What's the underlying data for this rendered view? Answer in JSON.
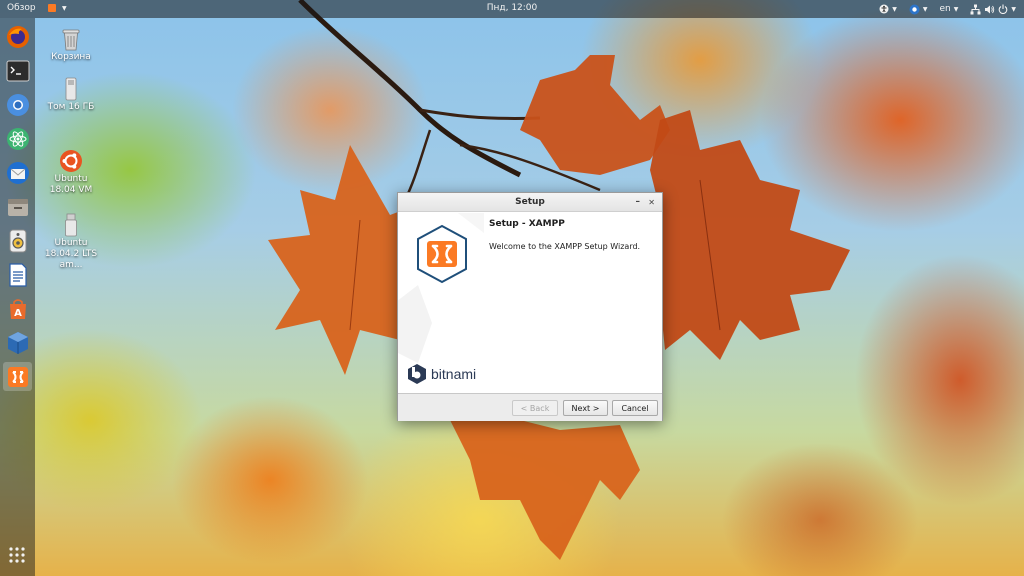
{
  "topbar": {
    "activities_label": "Обзор",
    "app_menu_icon": "xampp-icon",
    "clock": "Пнд, 12:00",
    "language": "en",
    "tray_icons": [
      "accessibility-icon",
      "browser-icon",
      "network-icon",
      "volume-icon",
      "power-icon"
    ]
  },
  "dock": {
    "items": [
      {
        "name": "firefox",
        "icon": "firefox-icon"
      },
      {
        "name": "terminal",
        "icon": "terminal-icon"
      },
      {
        "name": "chromium",
        "icon": "chromium-icon"
      },
      {
        "name": "atom",
        "icon": "atom-icon"
      },
      {
        "name": "thunderbird",
        "icon": "thunderbird-icon"
      },
      {
        "name": "files",
        "icon": "files-icon"
      },
      {
        "name": "rhythmbox",
        "icon": "speaker-icon"
      },
      {
        "name": "writer",
        "icon": "libreoffice-writer-icon"
      },
      {
        "name": "software",
        "icon": "software-center-icon"
      },
      {
        "name": "virtualbox",
        "icon": "virtualbox-icon"
      },
      {
        "name": "xampp",
        "icon": "xampp-icon",
        "active": true
      }
    ],
    "apps_grid_icon": "show-applications-icon"
  },
  "desktop": {
    "icons": [
      {
        "label": "Корзина",
        "icon": "trash-icon"
      },
      {
        "label": "Том 16 ГБ",
        "icon": "drive-icon"
      },
      {
        "label": "Ubuntu 18.04 VM",
        "icon": "ubuntu-icon"
      },
      {
        "label": "Ubuntu 18.04.2 LTS am...",
        "icon": "usb-drive-icon"
      }
    ]
  },
  "dialog": {
    "title": "Setup",
    "heading": "Setup - XAMPP",
    "message": "Welcome to the XAMPP Setup Wizard.",
    "brand": "bitnami",
    "buttons": {
      "back": "< Back",
      "next": "Next >",
      "cancel": "Cancel"
    },
    "back_disabled": true
  },
  "colors": {
    "xampp_orange": "#fb7a24",
    "xampp_border": "#1f4f7a",
    "bitnami_blue": "#2b3a55"
  }
}
